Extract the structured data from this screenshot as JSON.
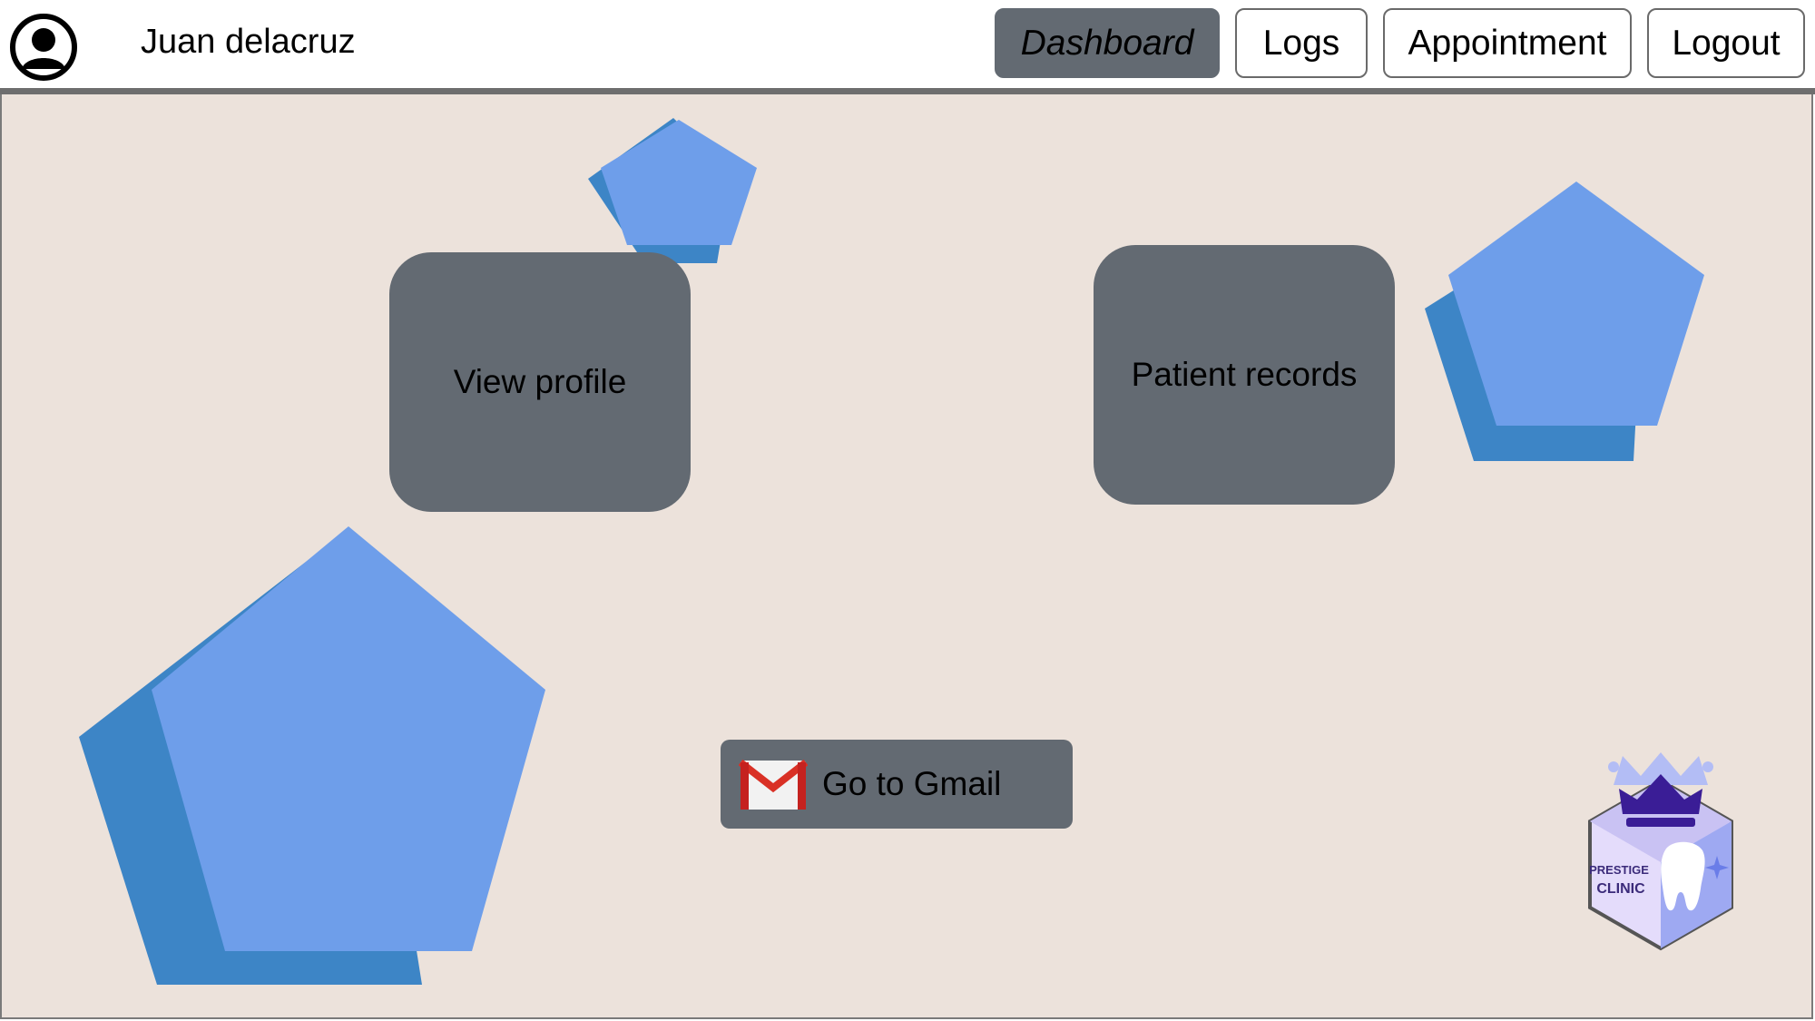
{
  "header": {
    "user_name": "Juan delacruz",
    "avatar_icon": "user-circle-icon"
  },
  "nav": {
    "items": [
      {
        "label": "Dashboard",
        "active": true
      },
      {
        "label": "Logs",
        "active": false
      },
      {
        "label": "Appointment",
        "active": false
      },
      {
        "label": "Logout",
        "active": false
      }
    ]
  },
  "main": {
    "cards": [
      {
        "label": "View profile"
      },
      {
        "label": "Patient records"
      }
    ],
    "gmail_button": {
      "label": "Go to Gmail",
      "icon": "gmail-icon"
    },
    "logo": {
      "line1": "PRESTIGE",
      "line2": "CLINIC",
      "icon": "crown-tooth-logo"
    }
  },
  "colors": {
    "background": "#ece2db",
    "button_gray": "#636a72",
    "pentagon_light": "#6e9eea",
    "pentagon_dark": "#3d85c6"
  }
}
